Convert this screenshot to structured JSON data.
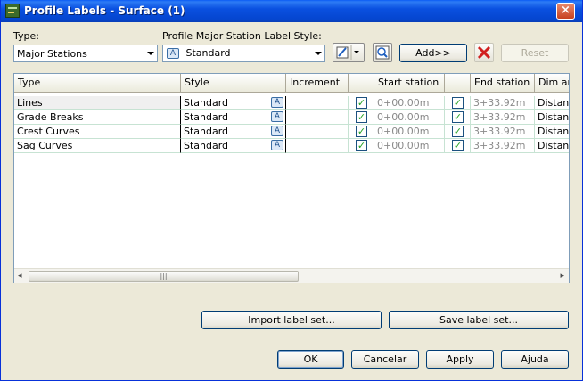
{
  "window": {
    "title": "Profile Labels - Surface (1)",
    "close_glyph": "×"
  },
  "type_label": "Type:",
  "type_value": "Major Stations",
  "style_label": "Profile Major Station Label Style:",
  "style_value": "Standard",
  "buttons": {
    "add": "Add>>",
    "reset": "Reset",
    "import": "Import label set...",
    "save": "Save label set...",
    "ok": "OK",
    "cancel": "Cancelar",
    "apply": "Apply",
    "help": "Ajuda"
  },
  "grid": {
    "headers": {
      "type": "Type",
      "style": "Style",
      "increment": "Increment",
      "start": "Start station",
      "end": "End station",
      "dim": "Dim an"
    },
    "rows": [
      {
        "type": "Lines",
        "style": "Standard",
        "increment": "",
        "start": "0+00.00m",
        "end": "3+33.92m",
        "dim": "Distanc"
      },
      {
        "type": "Grade Breaks",
        "style": "Standard",
        "increment": "",
        "start": "0+00.00m",
        "end": "3+33.92m",
        "dim": "Distanc"
      },
      {
        "type": "Crest Curves",
        "style": "Standard",
        "increment": "",
        "start": "0+00.00m",
        "end": "3+33.92m",
        "dim": "Distanc"
      },
      {
        "type": "Sag Curves",
        "style": "Standard",
        "increment": "",
        "start": "0+00.00m",
        "end": "3+33.92m",
        "dim": "Distanc"
      }
    ],
    "check_glyph": "✓",
    "scroll": {
      "left": "◂",
      "right": "▸",
      "thumb_grip": "|||"
    }
  },
  "icons": {
    "style": "label-style-icon",
    "edit": "edit-style-icon",
    "preview": "preview-icon",
    "delete": "delete-icon"
  },
  "colors": {
    "title_bar": "#0a50e0",
    "check": "#21a121",
    "delete": "#d11f1f"
  }
}
